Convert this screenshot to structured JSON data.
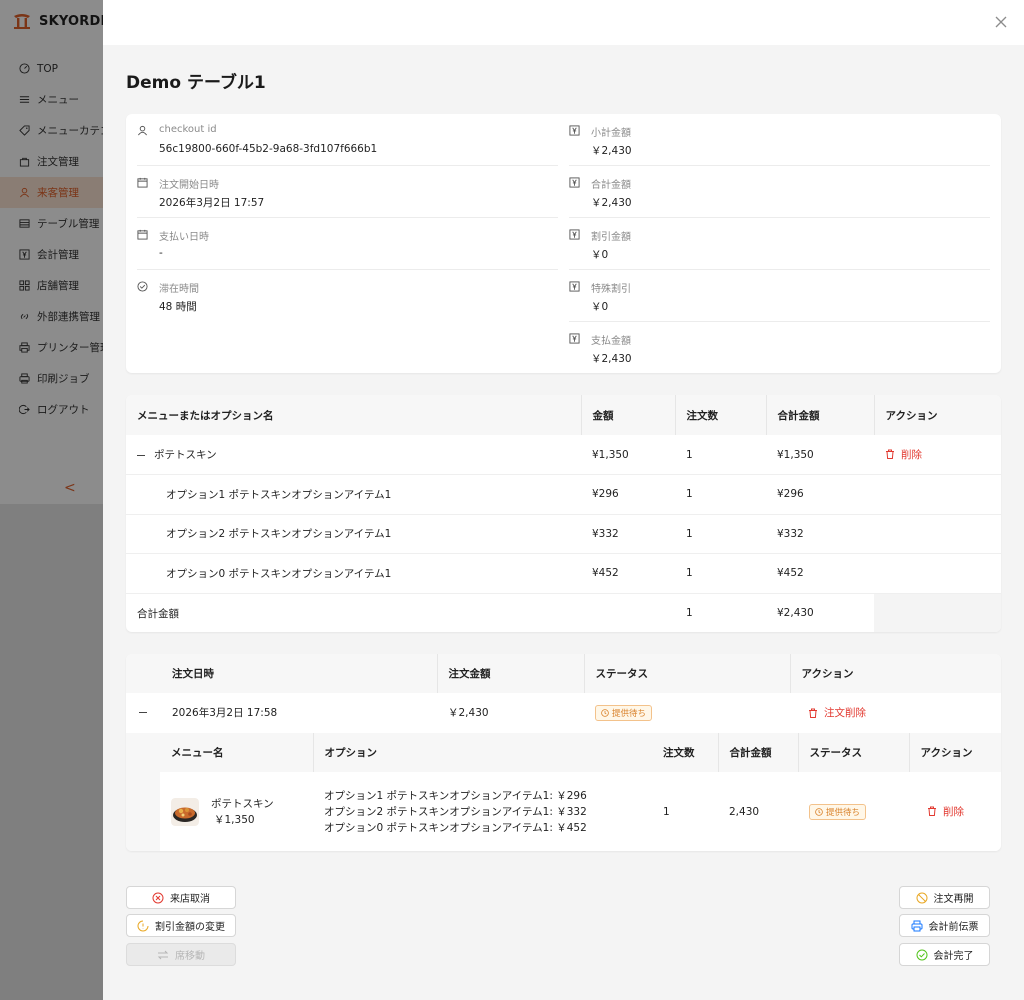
{
  "app": {
    "brand": "SKYORDER",
    "nav": [
      {
        "label": "TOP",
        "icon": "dashboard-icon"
      },
      {
        "label": "メニュー",
        "icon": "list-icon"
      },
      {
        "label": "メニューカテゴリ",
        "icon": "tag-icon"
      },
      {
        "label": "注文管理",
        "icon": "bag-icon"
      },
      {
        "label": "来客管理",
        "icon": "user-icon",
        "active": true
      },
      {
        "label": "テーブル管理",
        "icon": "table-icon"
      },
      {
        "label": "会計管理",
        "icon": "yen-icon"
      },
      {
        "label": "店舗管理",
        "icon": "shop-icon"
      },
      {
        "label": "外部連携管理",
        "icon": "link-icon"
      },
      {
        "label": "プリンター管理",
        "icon": "printer-icon"
      },
      {
        "label": "印刷ジョブ",
        "icon": "print-job-icon"
      },
      {
        "label": "ログアウト",
        "icon": "logout-icon"
      }
    ],
    "collapse_glyph": "<",
    "accent": "#e0612a"
  },
  "drawer": {
    "title": "Demo テーブル1",
    "info_left": [
      {
        "label": "checkout id",
        "value": "56c19800-660f-45b2-9a68-3fd107f666b1",
        "icon": "user-icon"
      },
      {
        "label": "注文開始日時",
        "value": "2026年3月2日 17:57",
        "icon": "calendar-icon"
      },
      {
        "label": "支払い日時",
        "value": "-",
        "icon": "calendar-icon"
      },
      {
        "label": "滞在時間",
        "value": "48 時間",
        "icon": "check-circle-icon"
      }
    ],
    "info_right": [
      {
        "label": "小計金額",
        "value": "￥2,430",
        "icon": "yen-icon"
      },
      {
        "label": "合計金額",
        "value": "￥2,430",
        "icon": "yen-icon"
      },
      {
        "label": "割引金額",
        "value": "￥0",
        "icon": "yen-icon"
      },
      {
        "label": "特殊割引",
        "value": "￥0",
        "icon": "yen-icon"
      },
      {
        "label": "支払金額",
        "value": "￥2,430",
        "icon": "yen-icon"
      }
    ],
    "menu_table": {
      "headers": [
        "メニューまたはオプション名",
        "金額",
        "注文数",
        "合計金額",
        "アクション"
      ],
      "rows": [
        {
          "name": "ポテトスキン",
          "price": "¥1,350",
          "qty": "1",
          "total": "¥1,350",
          "action": "削除",
          "expanded": true
        },
        {
          "name": "オプション1 ポテトスキンオプションアイテム1",
          "price": "¥296",
          "qty": "1",
          "total": "¥296"
        },
        {
          "name": "オプション2 ポテトスキンオプションアイテム1",
          "price": "¥332",
          "qty": "1",
          "total": "¥332"
        },
        {
          "name": "オプション0 ポテトスキンオプションアイテム1",
          "price": "¥452",
          "qty": "1",
          "total": "¥452"
        }
      ],
      "total_row": {
        "label": "合計金額",
        "qty": "1",
        "total": "¥2,430"
      }
    },
    "order_table": {
      "headers": [
        "注文日時",
        "注文金額",
        "ステータス",
        "アクション"
      ],
      "row": {
        "datetime": "2026年3月2日 17:58",
        "amount": "￥2,430",
        "status": "提供待ち",
        "action": "注文削除"
      },
      "nested": {
        "headers": [
          "メニュー名",
          "オプション",
          "注文数",
          "合計金額",
          "ステータス",
          "アクション"
        ],
        "item": {
          "name": "ポテトスキン",
          "price": "￥1,350",
          "options": [
            "オプション1 ポテトスキンオプションアイテム1: ￥296",
            "オプション2 ポテトスキンオプションアイテム1: ￥332",
            "オプション0 ポテトスキンオプションアイテム1: ￥452"
          ],
          "qty": "1",
          "total": "2,430",
          "status": "提供待ち",
          "action": "削除"
        }
      }
    },
    "buttons_left": [
      {
        "label": "来店取消",
        "icon": "cancel-circle-icon",
        "color": "#e2382f"
      },
      {
        "label": "割引金額の変更",
        "icon": "discount-icon",
        "color": "#e9a825"
      },
      {
        "label": "席移動",
        "icon": "swap-icon",
        "disabled": true
      }
    ],
    "buttons_right": [
      {
        "label": "注文再開",
        "icon": "reopen-icon",
        "color": "#e9a825"
      },
      {
        "label": "会計前伝票",
        "icon": "printer-icon",
        "color": "#1677ff"
      },
      {
        "label": "会計完了",
        "icon": "check-circle-icon",
        "color": "#52c41a"
      }
    ],
    "colors": {
      "danger": "#e2382f",
      "warning": "#d9822b"
    }
  }
}
